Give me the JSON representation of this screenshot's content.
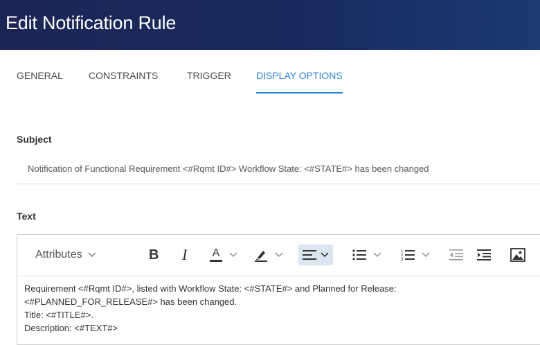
{
  "header": {
    "title": "Edit Notification Rule"
  },
  "tabs": [
    {
      "label": "GENERAL",
      "active": false
    },
    {
      "label": "CONSTRAINTS",
      "active": false
    },
    {
      "label": "TRIGGER",
      "active": false
    },
    {
      "label": "DISPLAY OPTIONS",
      "active": true
    }
  ],
  "subject": {
    "label": "Subject",
    "value": "Notification of Functional Requirement <#Rqmt ID#> Workflow State: <#STATE#> has been changed"
  },
  "text_section": {
    "label": "Text",
    "toolbar": {
      "attributes_label": "Attributes",
      "bold": "B",
      "italic": "I",
      "font_color": "A",
      "accent_color": "#2a83d8"
    },
    "body_lines": [
      "Requirement <#Rqmt ID#>, listed with Workflow State: <#STATE#> and Planned for Release:",
      "<#PLANNED_FOR_RELEASE#> has been changed.",
      "Title: <#TITLE#>.",
      "Description: <#TEXT#>"
    ]
  }
}
